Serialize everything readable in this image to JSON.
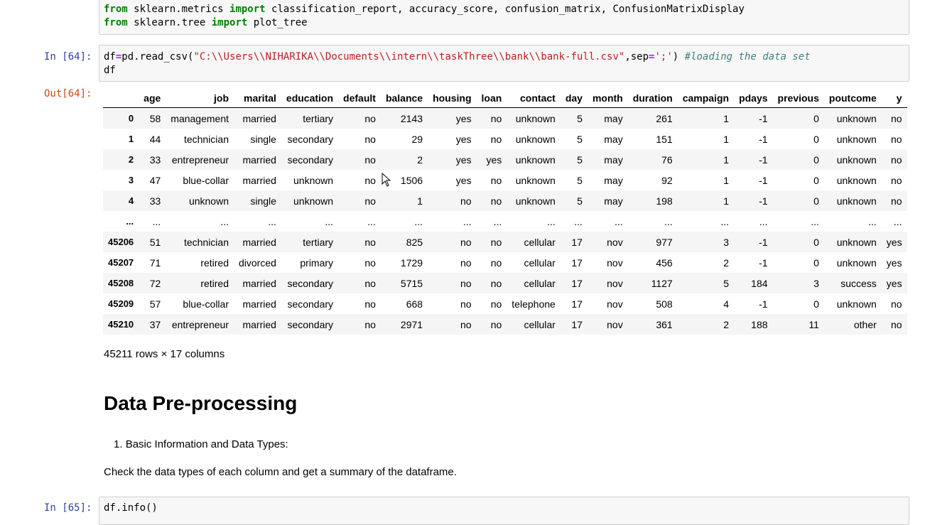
{
  "cell_prev": {
    "line1": {
      "kw_from": "from",
      "module": " sklearn.metrics ",
      "kw_import": "import",
      "rest": " classification_report, accuracy_score, confusion_matrix, ConfusionMatrixDisplay"
    },
    "line2": {
      "kw_from": "from",
      "module": " sklearn.tree ",
      "kw_import": "import",
      "rest": " plot_tree"
    }
  },
  "cell64": {
    "in_prompt": "In [64]:",
    "out_prompt": "Out[64]:",
    "code_a": "df",
    "code_eq": "=",
    "code_b": "pd.read_csv(",
    "code_path": "\"C:\\\\Users\\\\NIHARIKA\\\\Documents\\\\intern\\\\taskThree\\\\bank\\\\bank-full.csv\"",
    "code_c": ",sep",
    "code_eq2": "=",
    "code_sep": "';'",
    "code_d": ") ",
    "code_comment": "#loading the data set",
    "code_line2": "df"
  },
  "table": {
    "columns": [
      "",
      "age",
      "job",
      "marital",
      "education",
      "default",
      "balance",
      "housing",
      "loan",
      "contact",
      "day",
      "month",
      "duration",
      "campaign",
      "pdays",
      "previous",
      "poutcome",
      "y"
    ],
    "rows": [
      [
        "0",
        "58",
        "management",
        "married",
        "tertiary",
        "no",
        "2143",
        "yes",
        "no",
        "unknown",
        "5",
        "may",
        "261",
        "1",
        "-1",
        "0",
        "unknown",
        "no"
      ],
      [
        "1",
        "44",
        "technician",
        "single",
        "secondary",
        "no",
        "29",
        "yes",
        "no",
        "unknown",
        "5",
        "may",
        "151",
        "1",
        "-1",
        "0",
        "unknown",
        "no"
      ],
      [
        "2",
        "33",
        "entrepreneur",
        "married",
        "secondary",
        "no",
        "2",
        "yes",
        "yes",
        "unknown",
        "5",
        "may",
        "76",
        "1",
        "-1",
        "0",
        "unknown",
        "no"
      ],
      [
        "3",
        "47",
        "blue-collar",
        "married",
        "unknown",
        "no",
        "1506",
        "yes",
        "no",
        "unknown",
        "5",
        "may",
        "92",
        "1",
        "-1",
        "0",
        "unknown",
        "no"
      ],
      [
        "4",
        "33",
        "unknown",
        "single",
        "unknown",
        "no",
        "1",
        "no",
        "no",
        "unknown",
        "5",
        "may",
        "198",
        "1",
        "-1",
        "0",
        "unknown",
        "no"
      ],
      [
        "...",
        "...",
        "...",
        "...",
        "...",
        "...",
        "...",
        "...",
        "...",
        "...",
        "...",
        "...",
        "...",
        "...",
        "...",
        "...",
        "...",
        "..."
      ],
      [
        "45206",
        "51",
        "technician",
        "married",
        "tertiary",
        "no",
        "825",
        "no",
        "no",
        "cellular",
        "17",
        "nov",
        "977",
        "3",
        "-1",
        "0",
        "unknown",
        "yes"
      ],
      [
        "45207",
        "71",
        "retired",
        "divorced",
        "primary",
        "no",
        "1729",
        "no",
        "no",
        "cellular",
        "17",
        "nov",
        "456",
        "2",
        "-1",
        "0",
        "unknown",
        "yes"
      ],
      [
        "45208",
        "72",
        "retired",
        "married",
        "secondary",
        "no",
        "5715",
        "no",
        "no",
        "cellular",
        "17",
        "nov",
        "1127",
        "5",
        "184",
        "3",
        "success",
        "yes"
      ],
      [
        "45209",
        "57",
        "blue-collar",
        "married",
        "secondary",
        "no",
        "668",
        "no",
        "no",
        "telephone",
        "17",
        "nov",
        "508",
        "4",
        "-1",
        "0",
        "unknown",
        "no"
      ],
      [
        "45210",
        "37",
        "entrepreneur",
        "married",
        "secondary",
        "no",
        "2971",
        "no",
        "no",
        "cellular",
        "17",
        "nov",
        "361",
        "2",
        "188",
        "11",
        "other",
        "no"
      ]
    ],
    "shape_text": "45211 rows × 17 columns"
  },
  "markdown": {
    "heading": "Data Pre-processing",
    "list_number": "1.",
    "list_item": "Basic Information and Data Types:",
    "paragraph": "Check the data types of each column and get a summary of the dataframe."
  },
  "cell65": {
    "in_prompt": "In [65]:",
    "code": "df.info()"
  },
  "colors": {
    "in_prompt": "#303f9f",
    "out_prompt": "#d84315",
    "keyword": "#008000",
    "string": "#ba2121",
    "comment": "#408080"
  }
}
